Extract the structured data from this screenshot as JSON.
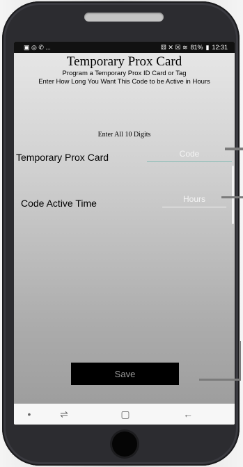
{
  "status_bar": {
    "left_icons": "▣ ◎ ✆ ...",
    "right_icons": "⚄ ✕ ☒ ≋ ",
    "battery": "81%",
    "battery_icon": "▮",
    "time": "12:31"
  },
  "header": {
    "title": "Temporary Prox Card",
    "subtitle": "Program a Temporary Prox ID Card or Tag",
    "instructions": "Enter How Long You Want This Code to be Active in Hours"
  },
  "form": {
    "digits_note": "Enter All 10 Digits",
    "card_label": "Temporary Prox Card",
    "code_placeholder": "Code",
    "time_label": "Code Active Time",
    "hours_placeholder": "Hours",
    "save_label": "Save"
  },
  "nav": {
    "dot": "•",
    "recent": "⇌",
    "home": "▢",
    "back": "←"
  },
  "colors": {
    "phone_body": "#2c2c30",
    "status_bar": "#111111",
    "save_button": "#000000",
    "code_underline": "#7fb9b2"
  }
}
